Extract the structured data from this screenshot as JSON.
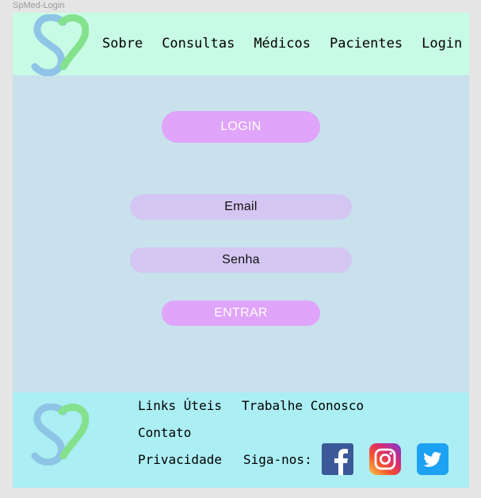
{
  "frame": {
    "label": "SpMed-Login"
  },
  "header": {
    "logo_icon": "spmed-heart-logo",
    "nav": [
      {
        "label": "Sobre"
      },
      {
        "label": "Consultas"
      },
      {
        "label": "Médicos"
      },
      {
        "label": "Pacientes"
      },
      {
        "label": "Login"
      }
    ]
  },
  "main": {
    "title": "LOGIN",
    "email": {
      "placeholder": "Email",
      "value": ""
    },
    "password": {
      "placeholder": "Senha",
      "value": ""
    },
    "submit_label": "ENTRAR"
  },
  "footer": {
    "logo_icon": "spmed-heart-logo",
    "links": {
      "useful": "Links Úteis",
      "work": "Trabalhe Conosco",
      "contact": "Contato",
      "privacy": "Privacidade"
    },
    "follow_label": "Siga-nos:",
    "social": [
      {
        "name": "facebook-icon"
      },
      {
        "name": "instagram-icon"
      },
      {
        "name": "twitter-icon"
      }
    ]
  },
  "colors": {
    "background": "#c8e1ec",
    "header_bg": "#c8fbe5",
    "footer_bg": "#abeef3",
    "button_bg": "#e0a4fa",
    "field_bg": "#d4c6f2",
    "logo_blue": "#8ec5e6",
    "logo_green": "#84e18d",
    "facebook": "#3b5998",
    "twitter": "#1da1f2"
  }
}
